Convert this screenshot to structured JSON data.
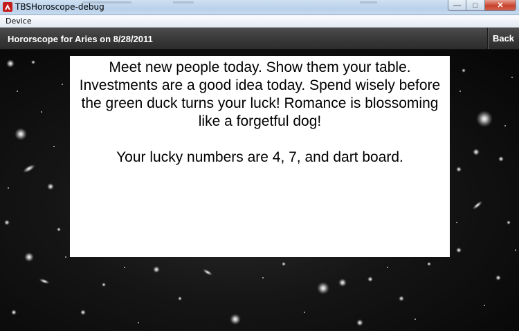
{
  "window": {
    "title": "TBSHoroscope-debug",
    "close_glyph": "✕",
    "max_glyph": "□",
    "min_glyph": "—"
  },
  "menu": {
    "items": [
      "Device"
    ]
  },
  "header": {
    "title": "Hororscope for Aries on 8/28/2011",
    "back_label": "Back"
  },
  "content": {
    "reading": "Meet new people today. Show them your table. Investments are a good idea today. Spend wisely before the green duck turns your luck! Romance is blossoming like a forgetful dog!",
    "lucky": "Your lucky numbers are 4, 7, and dart board."
  },
  "colors": {
    "header_bg": "#3a3a3a",
    "card_bg": "#ffffff",
    "titlebar_bg": "#c4d8ee"
  }
}
